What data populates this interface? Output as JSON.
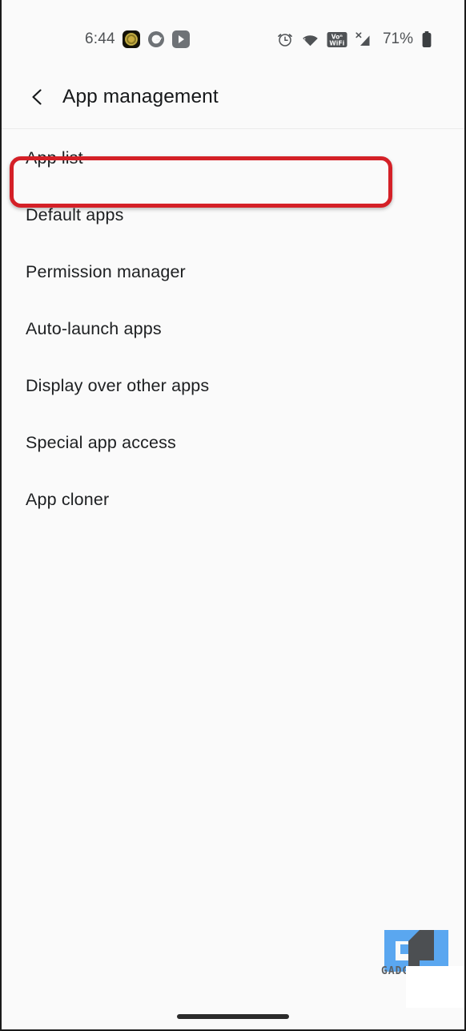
{
  "statusbar": {
    "time": "6:44",
    "battery_percent": "71%",
    "left_icons": [
      {
        "name": "app-icon-gold-emblem"
      },
      {
        "name": "google-icon"
      },
      {
        "name": "youtube-icon"
      }
    ],
    "right_icons": [
      {
        "name": "alarm-clock-icon"
      },
      {
        "name": "wifi-icon"
      },
      {
        "name": "vowifi-icon",
        "label_top": "Voⁿ",
        "label_bottom": "WiFi"
      },
      {
        "name": "signal-bars-x-icon",
        "label": "X"
      },
      {
        "name": "battery-icon"
      }
    ]
  },
  "header": {
    "back_label": "Back",
    "title": "App management"
  },
  "list": {
    "items": [
      {
        "label": "App list",
        "highlighted": true
      },
      {
        "label": "Default apps",
        "highlighted": false
      },
      {
        "label": "Permission manager",
        "highlighted": false
      },
      {
        "label": "Auto-launch apps",
        "highlighted": false
      },
      {
        "label": "Display over other apps",
        "highlighted": false
      },
      {
        "label": "Special app access",
        "highlighted": false
      },
      {
        "label": "App cloner",
        "highlighted": false
      }
    ]
  },
  "annotation": {
    "target": "App list",
    "color": "#d42027"
  },
  "watermark": {
    "text": "GADG",
    "brand_color": "#5aa7f0",
    "accent_color": "#4c4f52"
  },
  "navbar": {
    "gesture_pill": "home-gesture-pill"
  }
}
